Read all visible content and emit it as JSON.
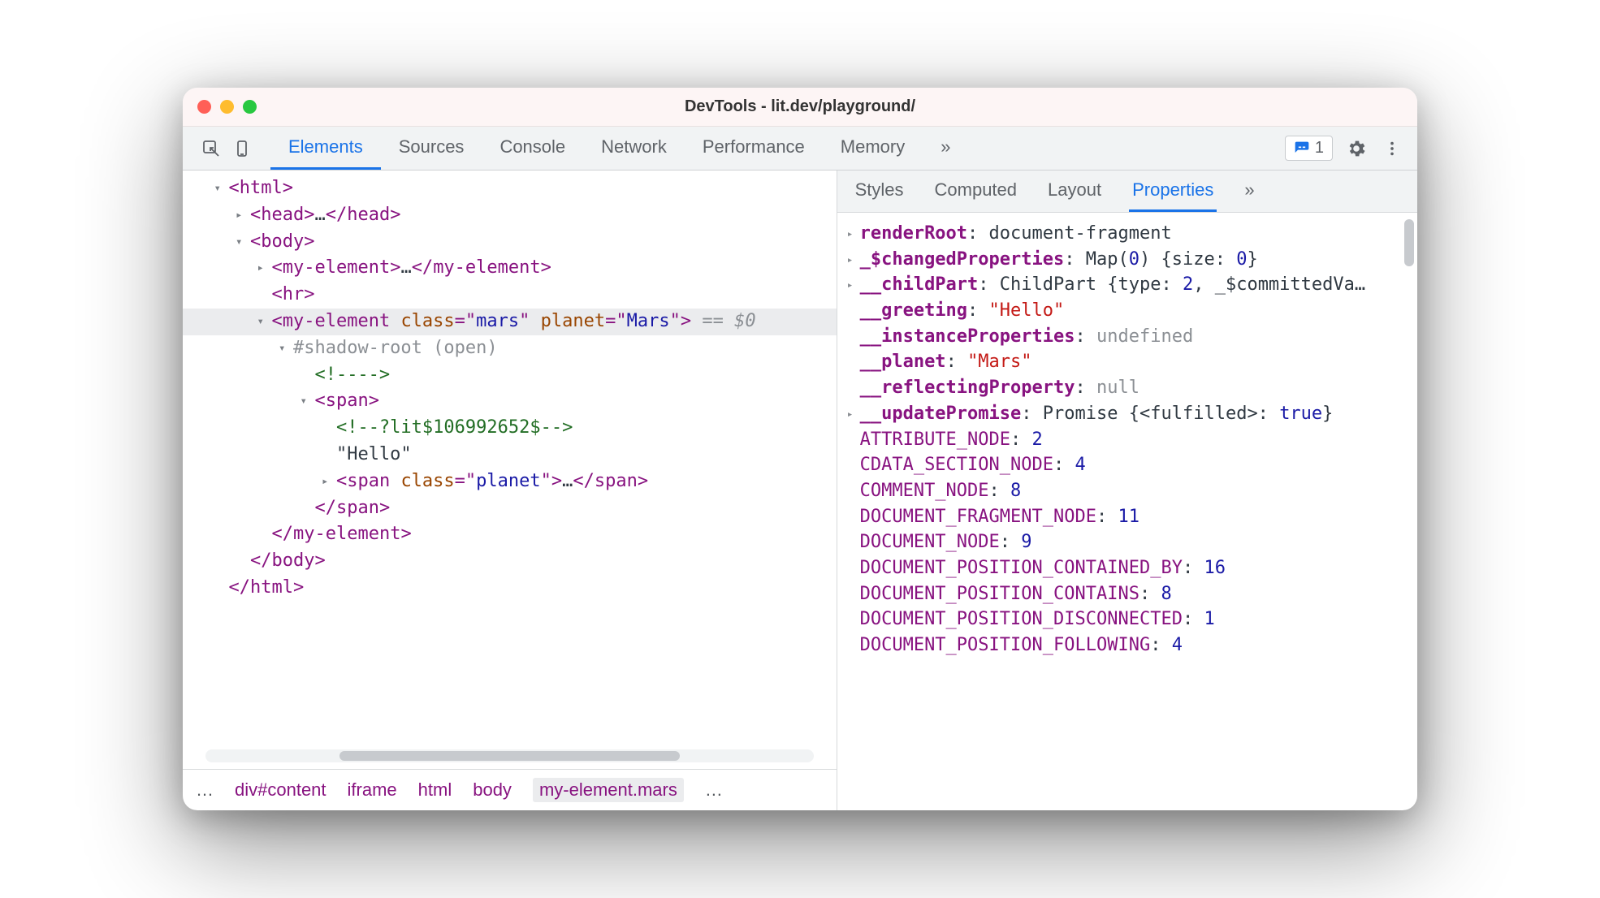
{
  "window": {
    "title": "DevTools - lit.dev/playground/"
  },
  "traffic": {
    "close": "close",
    "min": "minimize",
    "max": "maximize"
  },
  "mainTabs": {
    "items": [
      "Elements",
      "Sources",
      "Console",
      "Network",
      "Performance",
      "Memory"
    ],
    "more": "»",
    "activeIndex": 0
  },
  "issues": {
    "count": "1"
  },
  "domTree": {
    "lines": [
      {
        "indent": 1,
        "caret": "open",
        "html": "<html>"
      },
      {
        "indent": 2,
        "caret": "closed",
        "html": "<head>…</head>"
      },
      {
        "indent": 2,
        "caret": "open",
        "html": "<body>"
      },
      {
        "indent": 3,
        "caret": "closed",
        "html": "<my-element>…</my-element>"
      },
      {
        "indent": 3,
        "caret": "none",
        "html": "<hr>"
      },
      {
        "indent": 3,
        "caret": "open",
        "selected": true,
        "html_open_tag": "my-element",
        "attrs": [
          [
            "class",
            "mars"
          ],
          [
            "planet",
            "Mars"
          ]
        ],
        "hint": " == $0"
      },
      {
        "indent": 4,
        "caret": "open",
        "shadow": "#shadow-root (open)"
      },
      {
        "indent": 5,
        "caret": "none",
        "comment": "<!---->"
      },
      {
        "indent": 5,
        "caret": "open",
        "html": "<span>"
      },
      {
        "indent": 6,
        "caret": "none",
        "comment": "<!--?lit$106992652$-->"
      },
      {
        "indent": 6,
        "caret": "none",
        "text": "\"Hello\""
      },
      {
        "indent": 6,
        "caret": "closed",
        "html_open_tag": "span",
        "attrs": [
          [
            "class",
            "planet"
          ]
        ],
        "trail": "…</span>"
      },
      {
        "indent": 5,
        "caret": "none",
        "html": "</span>"
      },
      {
        "indent": 3,
        "caret": "none",
        "html": "</my-element>"
      },
      {
        "indent": 2,
        "caret": "none",
        "html": "</body>"
      },
      {
        "indent": 1,
        "caret": "none",
        "html": "</html>"
      }
    ]
  },
  "breadcrumbs": {
    "pre": "…",
    "items": [
      "div#content",
      "iframe",
      "html",
      "body",
      "my-element.mars"
    ],
    "post": "…",
    "activeIndex": 4
  },
  "rightTabs": {
    "items": [
      "Styles",
      "Computed",
      "Layout",
      "Properties"
    ],
    "more": "»",
    "activeIndex": 3
  },
  "properties": [
    {
      "caret": true,
      "key": "renderRoot",
      "keyBold": true,
      "valType": "obj",
      "val": "document-fragment"
    },
    {
      "caret": true,
      "key": "_$changedProperties",
      "keyBold": true,
      "valType": "obj",
      "val": "Map(0) {size: 0}"
    },
    {
      "caret": true,
      "key": "__childPart",
      "keyBold": true,
      "valType": "obj",
      "val": "ChildPart {type: 2, _$committedVa…"
    },
    {
      "caret": false,
      "key": "__greeting",
      "keyBold": true,
      "valType": "str",
      "val": "\"Hello\""
    },
    {
      "caret": false,
      "key": "__instanceProperties",
      "keyBold": true,
      "valType": "kw",
      "val": "undefined"
    },
    {
      "caret": false,
      "key": "__planet",
      "keyBold": true,
      "valType": "str",
      "val": "\"Mars\""
    },
    {
      "caret": false,
      "key": "__reflectingProperty",
      "keyBold": true,
      "valType": "kw",
      "val": "null"
    },
    {
      "caret": true,
      "key": "__updatePromise",
      "keyBold": true,
      "valType": "obj",
      "val": "Promise {<fulfilled>: true}"
    },
    {
      "caret": false,
      "key": "ATTRIBUTE_NODE",
      "valType": "num",
      "val": "2"
    },
    {
      "caret": false,
      "key": "CDATA_SECTION_NODE",
      "valType": "num",
      "val": "4"
    },
    {
      "caret": false,
      "key": "COMMENT_NODE",
      "valType": "num",
      "val": "8"
    },
    {
      "caret": false,
      "key": "DOCUMENT_FRAGMENT_NODE",
      "valType": "num",
      "val": "11"
    },
    {
      "caret": false,
      "key": "DOCUMENT_NODE",
      "valType": "num",
      "val": "9"
    },
    {
      "caret": false,
      "key": "DOCUMENT_POSITION_CONTAINED_BY",
      "valType": "num",
      "val": "16"
    },
    {
      "caret": false,
      "key": "DOCUMENT_POSITION_CONTAINS",
      "valType": "num",
      "val": "8"
    },
    {
      "caret": false,
      "key": "DOCUMENT_POSITION_DISCONNECTED",
      "valType": "num",
      "val": "1"
    },
    {
      "caret": false,
      "key": "DOCUMENT_POSITION_FOLLOWING",
      "valType": "num",
      "val": "4"
    }
  ]
}
